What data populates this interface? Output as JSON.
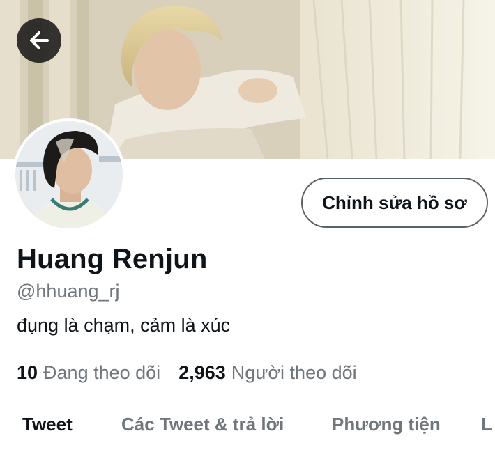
{
  "header": {
    "back_icon": "arrow-left-icon",
    "edit_button_label": "Chỉnh sửa hồ sơ"
  },
  "profile": {
    "name": "Huang Renjun",
    "handle": "@hhuang_rj",
    "bio": "đụng là chạm, cảm là xúc",
    "following_count": "10",
    "following_label": "Đang theo dõi",
    "followers_count": "2,963",
    "followers_label": "Người theo dõi"
  },
  "tabs": [
    {
      "label": "Tweet",
      "active": true
    },
    {
      "label": "Các Tweet & trả lời",
      "active": false
    },
    {
      "label": "Phương tiện",
      "active": false
    },
    {
      "label": "L",
      "active": false
    }
  ],
  "colors": {
    "text_primary": "#0f1419",
    "text_secondary": "#6f767c",
    "button_border": "#5a6268"
  }
}
